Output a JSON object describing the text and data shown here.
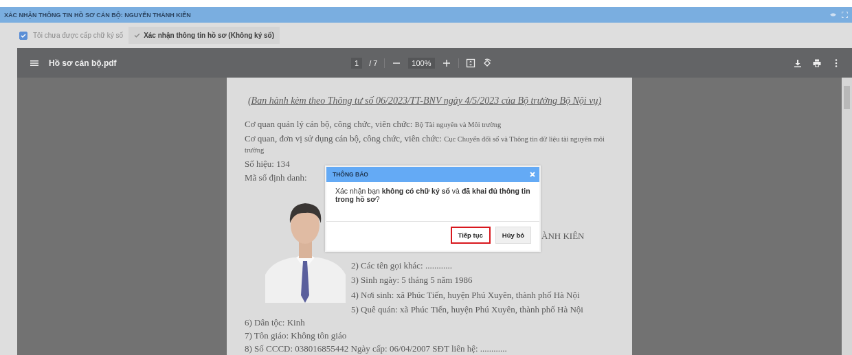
{
  "window": {
    "title": "XÁC NHẬN THÔNG TIN HỒ SƠ CÁN BỘ: NGUYỄN THÀNH KIÊN"
  },
  "options": {
    "checkbox": {
      "label": "Tôi chưa được cấp chữ ký số",
      "checked": true
    },
    "confirm_button": "Xác nhận thông tin hồ sơ (Không ký số)"
  },
  "pdf_viewer": {
    "file_name": "Hồ sơ cán bộ.pdf",
    "page": "1",
    "page_count": "/ 7",
    "zoom": "100%"
  },
  "document": {
    "heading": "(Ban hành kèm theo Thông tư số 06/2023/TT-BNV ngày 4/5/2023 của Bộ trưởng Bộ Nội vụ)",
    "lines": [
      {
        "label": "Cơ quan quản lý cán bộ, công chức, viên chức:",
        "value": "Bộ Tài nguyên và Môi trường"
      },
      {
        "label": "Cơ quan, đơn vị sử dụng cán bộ, công chức, viên chức:",
        "value": "Cục Chuyển đổi số và Thông tin dữ liệu tài nguyên môi trường"
      },
      {
        "label": "Số hiệu: 134"
      },
      {
        "label": "Mã số định danh:"
      }
    ],
    "photo": {
      "kind": "picture"
    },
    "photo_lines": [
      {
        "kind": "fragment",
        "text": "ÀNH KIÊN"
      },
      {
        "kind": "line",
        "text": "2) Các tên gọi khác: ............"
      },
      {
        "kind": "line",
        "text": "3) Sinh ngày: 5 tháng 5 năm 1986"
      },
      {
        "kind": "line",
        "text": "4) Nơi sinh: xã Phúc Tiến, huyện Phú Xuyên, thành phố Hà Nội"
      },
      {
        "kind": "line",
        "text": "5) Quê quán: xã Phúc Tiến, huyện Phú Xuyên, thành phố Hà Nội"
      }
    ],
    "more_lines": [
      "6) Dân tộc: Kinh",
      "7) Tôn giáo: Không tôn giáo",
      "8) Số CCCD: 038016855442 Ngày cấp: 06/04/2007 SĐT liên hệ: ............"
    ]
  },
  "dialog": {
    "title": "THÔNG BÁO",
    "message": "Xác nhận bạn **không có chữ ký số** và **đã khai đủ thông tin trong hồ sơ**?",
    "buttons": [
      {
        "label": "Tiếp tục",
        "focused": true
      },
      {
        "label": "Hủy bỏ",
        "focused": false
      }
    ]
  }
}
